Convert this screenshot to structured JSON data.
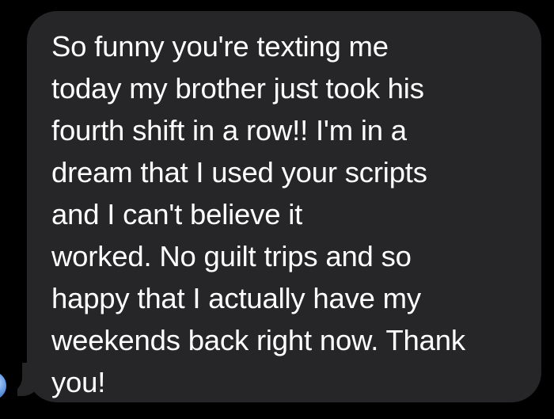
{
  "conversation": {
    "incoming_message": {
      "lines": [
        "So funny you're texting me",
        "today my brother just took his",
        "fourth shift in a row!! I'm in a",
        "dream that I used your scripts",
        "and I can't believe it",
        "worked. No guilt trips and so",
        "happy that I actually have my",
        "weekends back right now. Thank",
        "you!"
      ]
    },
    "sender_avatar": {
      "icon": "contact-avatar"
    }
  },
  "colors": {
    "background": "#000000",
    "bubble": "#262629",
    "text": "#ffffff"
  }
}
